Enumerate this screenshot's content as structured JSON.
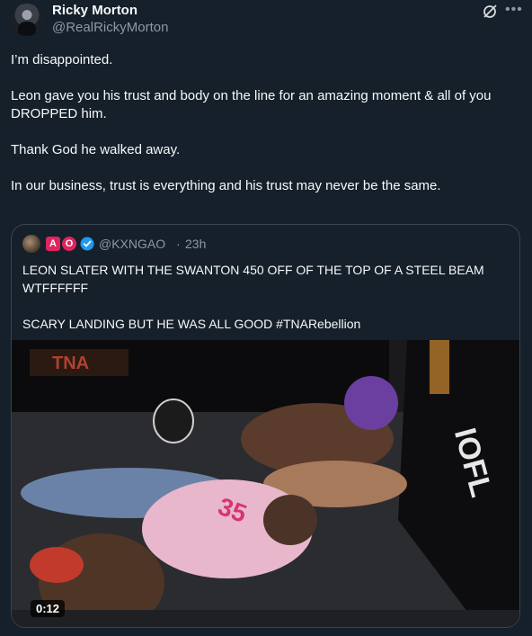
{
  "author": {
    "display_name": "Ricky Morton",
    "handle": "@RealRickyMorton"
  },
  "tweet": {
    "paragraphs": [
      "I’m disappointed.",
      "Leon gave you his trust and body on the line for an amazing moment & all of you DROPPED him.",
      "Thank God he walked away.",
      "In our business, trust is everything and his trust may never be the same."
    ]
  },
  "quoted": {
    "badge_a": "A",
    "badge_o": "O",
    "handle": "@KXNGAO",
    "separator": "·",
    "time": "23h",
    "paragraphs": [
      "LEON SLATER WITH THE SWANTON 450 OFF OF THE TOP OF A STEEL BEAM WTFFFFFF",
      "SCARY LANDING BUT HE WAS ALL GOOD #TNARebellion"
    ],
    "video": {
      "duration": "0:12",
      "banner_text": "TNA",
      "barrier_text": "IOFL",
      "shirt_text": "35"
    }
  },
  "icons": {
    "grok": "grok-icon",
    "more": "more-icon",
    "verified": "verified-icon"
  },
  "colors": {
    "background": "#15202b",
    "text_primary": "#f7f9f9",
    "text_secondary": "#8b98a5",
    "border": "#38444d",
    "verified": "#1d9bf0"
  }
}
